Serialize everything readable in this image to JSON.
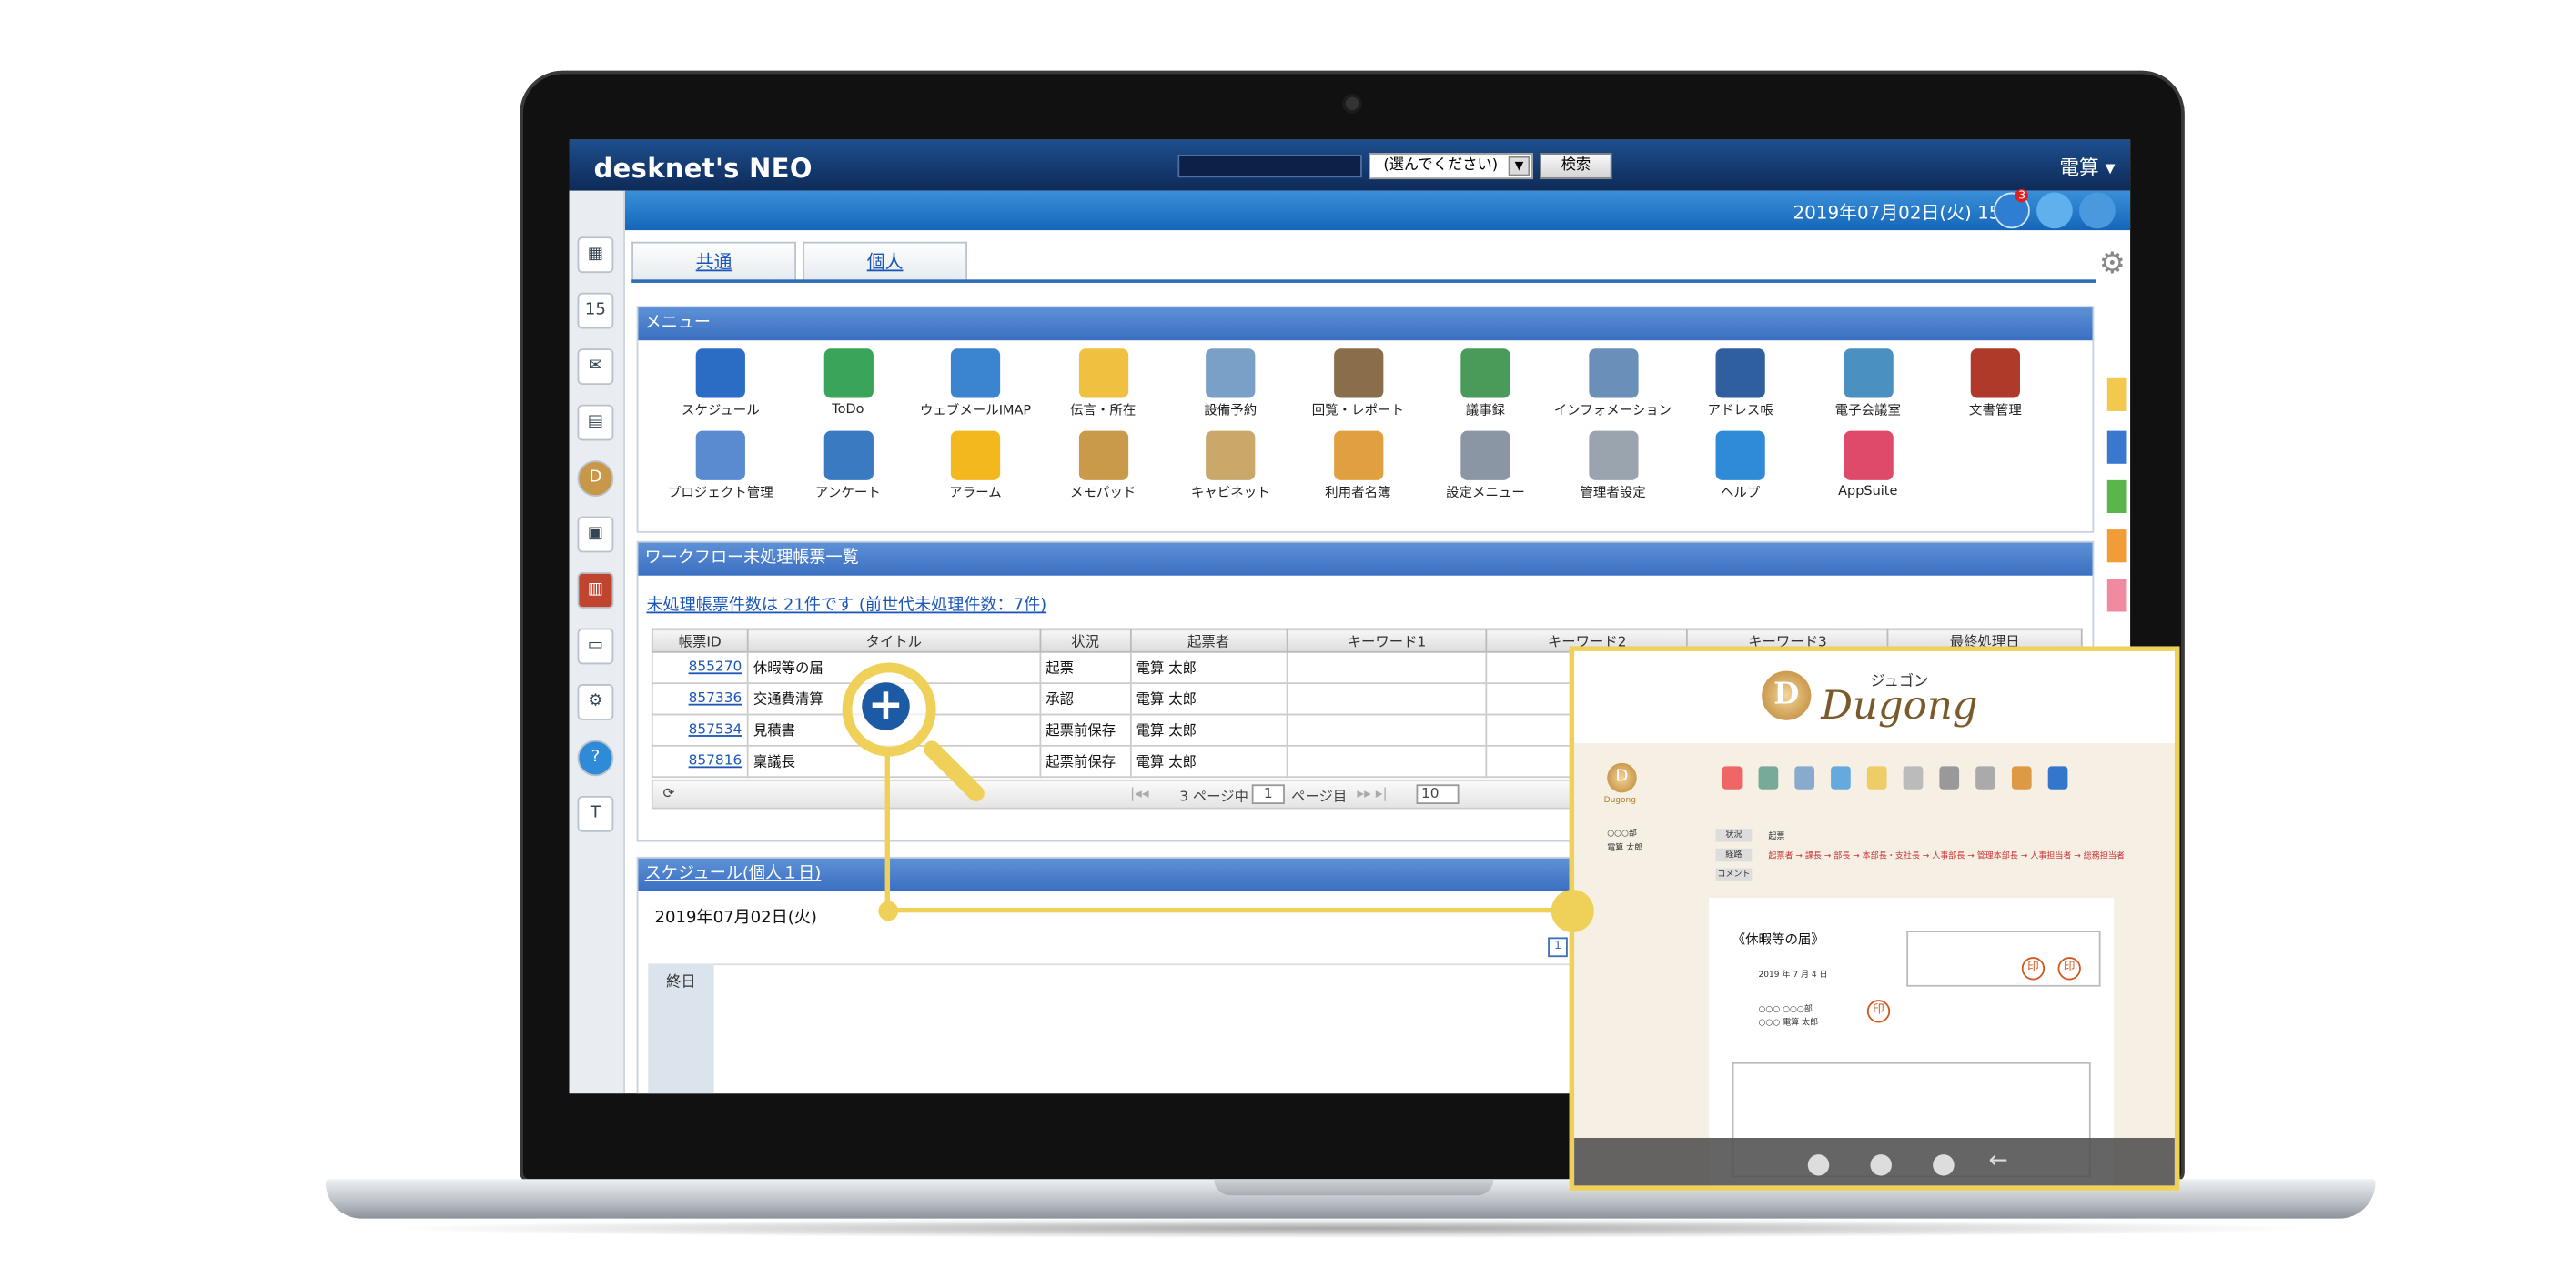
{
  "topbar": {
    "brand": "desknet's NEO",
    "select_value": "(選んでください)",
    "search_button": "検索",
    "user_menu": "電算 ▾"
  },
  "subbar": {
    "datetime": "2019年07月02日(火) 15:28",
    "notification_count": "3"
  },
  "tabs": [
    {
      "label": "共通"
    },
    {
      "label": "個人"
    }
  ],
  "menu": {
    "title": "メニュー",
    "items": [
      {
        "label": "スケジュール",
        "icon": "calendar-icon",
        "color": "#2b6cc4"
      },
      {
        "label": "ToDo",
        "icon": "todo-icon",
        "color": "#3aa55a"
      },
      {
        "label": "ウェブメールIMAP",
        "icon": "webmail-icon",
        "color": "#3a84d0"
      },
      {
        "label": "伝言・所在",
        "icon": "memo-note-icon",
        "color": "#f0c040"
      },
      {
        "label": "設備予約",
        "icon": "facility-icon",
        "color": "#7aa0c8"
      },
      {
        "label": "回覧・レポート",
        "icon": "clipboard-icon",
        "color": "#8a6d4a"
      },
      {
        "label": "議事録",
        "icon": "minutes-icon",
        "color": "#4a9a5a"
      },
      {
        "label": "インフォメーション",
        "icon": "information-icon",
        "color": "#6a8fb8"
      },
      {
        "label": "アドレス帳",
        "icon": "address-book-icon",
        "color": "#2f5f9f"
      },
      {
        "label": "電子会議室",
        "icon": "meeting-room-icon",
        "color": "#4a90c0"
      },
      {
        "label": "文書管理",
        "icon": "binder-icon",
        "color": "#b03a2a"
      },
      {
        "label": "プロジェクト管理",
        "icon": "project-icon",
        "color": "#5a8ad0"
      },
      {
        "label": "アンケート",
        "icon": "survey-icon",
        "color": "#3a7ac0"
      },
      {
        "label": "アラーム",
        "icon": "alarm-bell-icon",
        "color": "#f2b81e"
      },
      {
        "label": "メモパッド",
        "icon": "memopad-icon",
        "color": "#c89a4a"
      },
      {
        "label": "キャビネット",
        "icon": "cabinet-icon",
        "color": "#c9a86a"
      },
      {
        "label": "利用者名簿",
        "icon": "user-directory-icon",
        "color": "#e0a040"
      },
      {
        "label": "設定メニュー",
        "icon": "settings-menu-icon",
        "color": "#8a96a4"
      },
      {
        "label": "管理者設定",
        "icon": "admin-gear-icon",
        "color": "#9aa4ae"
      },
      {
        "label": "ヘルプ",
        "icon": "help-icon",
        "color": "#2f8ad8"
      },
      {
        "label": "AppSuite",
        "icon": "appsuite-icon",
        "color": "#e04a6a"
      }
    ]
  },
  "workflow": {
    "title": "ワークフロー未処理帳票一覧",
    "link": "未処理帳票件数は 21件です (前世代未処理件数：7件)",
    "columns": [
      "帳票ID",
      "タイトル",
      "状況",
      "起票者",
      "キーワード1",
      "キーワード2",
      "キーワード3",
      "最終処理日"
    ],
    "rows": [
      {
        "id": "855270",
        "title": "休暇等の届",
        "status": "起票",
        "author": "電算 太郎"
      },
      {
        "id": "857336",
        "title": "交通費清算",
        "status": "承認",
        "author": "電算 太郎"
      },
      {
        "id": "857534",
        "title": "見積書",
        "status": "起票前保存",
        "author": "電算 太郎"
      },
      {
        "id": "857816",
        "title": "稟議長",
        "status": "起票前保存",
        "author": "電算 太郎"
      }
    ],
    "pager": {
      "page_text": "3 ページ中",
      "page_value": "1",
      "page_suffix": "ページ目",
      "per_page": "10"
    }
  },
  "schedule": {
    "title": "スケジュール(個人１日)",
    "date": "2019年07月02日(火)",
    "allday_label": "終日",
    "mini_cal_day": "1"
  },
  "popup": {
    "brand_kana": "ジュゴン",
    "brand": "Dugong",
    "logo_letter": "D",
    "small_logo_text": "Dugong",
    "applicant_dept": "○○○部",
    "applicant_name": "電算 太郎",
    "field_labels": [
      "状況",
      "経路",
      "コメント"
    ],
    "status_value": "起票",
    "route_text": "起票者 → 課長 → 部長 → 本部長・支社長 → 人事部長 → 管理本部長 → 人事担当者 → 総務担当者",
    "doc_title": "《休暇等の届》",
    "stamp_char": "印",
    "dept_value": "○○○ ○○○部",
    "name_value": "○○○ 電算 太郎",
    "date_value": "2019 年 7 月 4 日"
  },
  "colors": {
    "topbar": "#0e2a57",
    "accent": "#3b6fc2",
    "highlight": "#efd15a"
  }
}
